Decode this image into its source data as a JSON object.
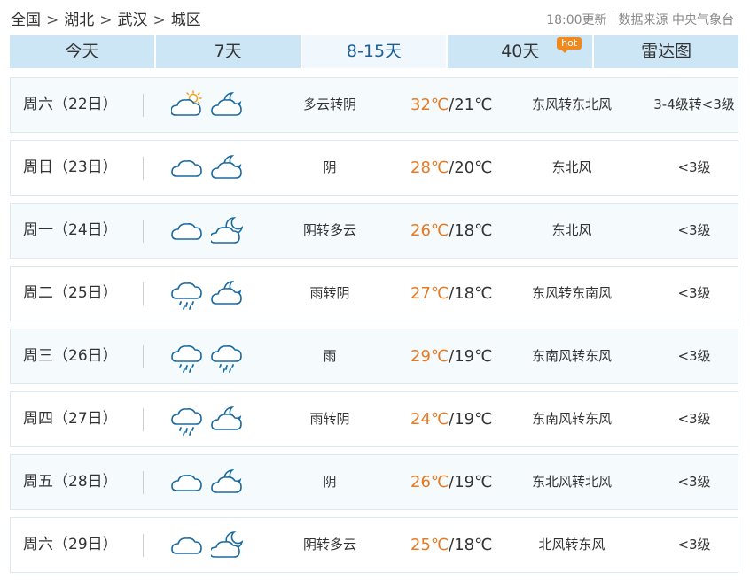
{
  "breadcrumb": [
    "全国",
    "湖北",
    "武汉",
    "城区"
  ],
  "breadcrumb_sep": ">",
  "update": {
    "time": "18:00更新",
    "source": "数据来源 中央气象台"
  },
  "tabs": [
    {
      "label": "今天",
      "active": false
    },
    {
      "label": "7天",
      "active": false
    },
    {
      "label": "8-15天",
      "active": true
    },
    {
      "label": "40天",
      "active": false,
      "badge": "hot"
    },
    {
      "label": "雷达图",
      "active": false
    }
  ],
  "colors": {
    "accent": "#1f5f95",
    "high_temp": "#e67a23",
    "tab_bg": "#cde6f6",
    "badge": "#f08a1e",
    "icon": "#1a6aa0"
  },
  "forecast": [
    {
      "day": "周六（22日）",
      "icon_day": "partly-cloudy-sun-icon",
      "icon_night": "cloudy-moon-icon",
      "condition": "多云转阴",
      "high": "32℃",
      "low": "/21℃",
      "wind": "东风转东北风",
      "level": "3-4级转<3级"
    },
    {
      "day": "周日（23日）",
      "icon_day": "cloud-icon",
      "icon_night": "cloudy-moon-icon",
      "condition": "阴",
      "high": "28℃",
      "low": "/20℃",
      "wind": "东北风",
      "level": "<3级"
    },
    {
      "day": "周一（24日）",
      "icon_day": "cloud-icon",
      "icon_night": "partly-cloudy-moon-icon",
      "condition": "阴转多云",
      "high": "26℃",
      "low": "/18℃",
      "wind": "东北风",
      "level": "<3级"
    },
    {
      "day": "周二（25日）",
      "icon_day": "rain-icon",
      "icon_night": "cloudy-moon-icon",
      "condition": "雨转阴",
      "high": "27℃",
      "low": "/18℃",
      "wind": "东风转东南风",
      "level": "<3级"
    },
    {
      "day": "周三（26日）",
      "icon_day": "rain-icon",
      "icon_night": "rain-icon",
      "condition": "雨",
      "high": "29℃",
      "low": "/19℃",
      "wind": "东南风转东风",
      "level": "<3级"
    },
    {
      "day": "周四（27日）",
      "icon_day": "rain-icon",
      "icon_night": "cloudy-moon-icon",
      "condition": "雨转阴",
      "high": "24℃",
      "low": "/19℃",
      "wind": "东南风转东风",
      "level": "<3级"
    },
    {
      "day": "周五（28日）",
      "icon_day": "cloud-icon",
      "icon_night": "cloudy-moon-icon",
      "condition": "阴",
      "high": "26℃",
      "low": "/19℃",
      "wind": "东北风转北风",
      "level": "<3级"
    },
    {
      "day": "周六（29日）",
      "icon_day": "cloud-icon",
      "icon_night": "partly-cloudy-moon-icon",
      "condition": "阴转多云",
      "high": "25℃",
      "low": "/18℃",
      "wind": "北风转东风",
      "level": "<3级"
    }
  ]
}
